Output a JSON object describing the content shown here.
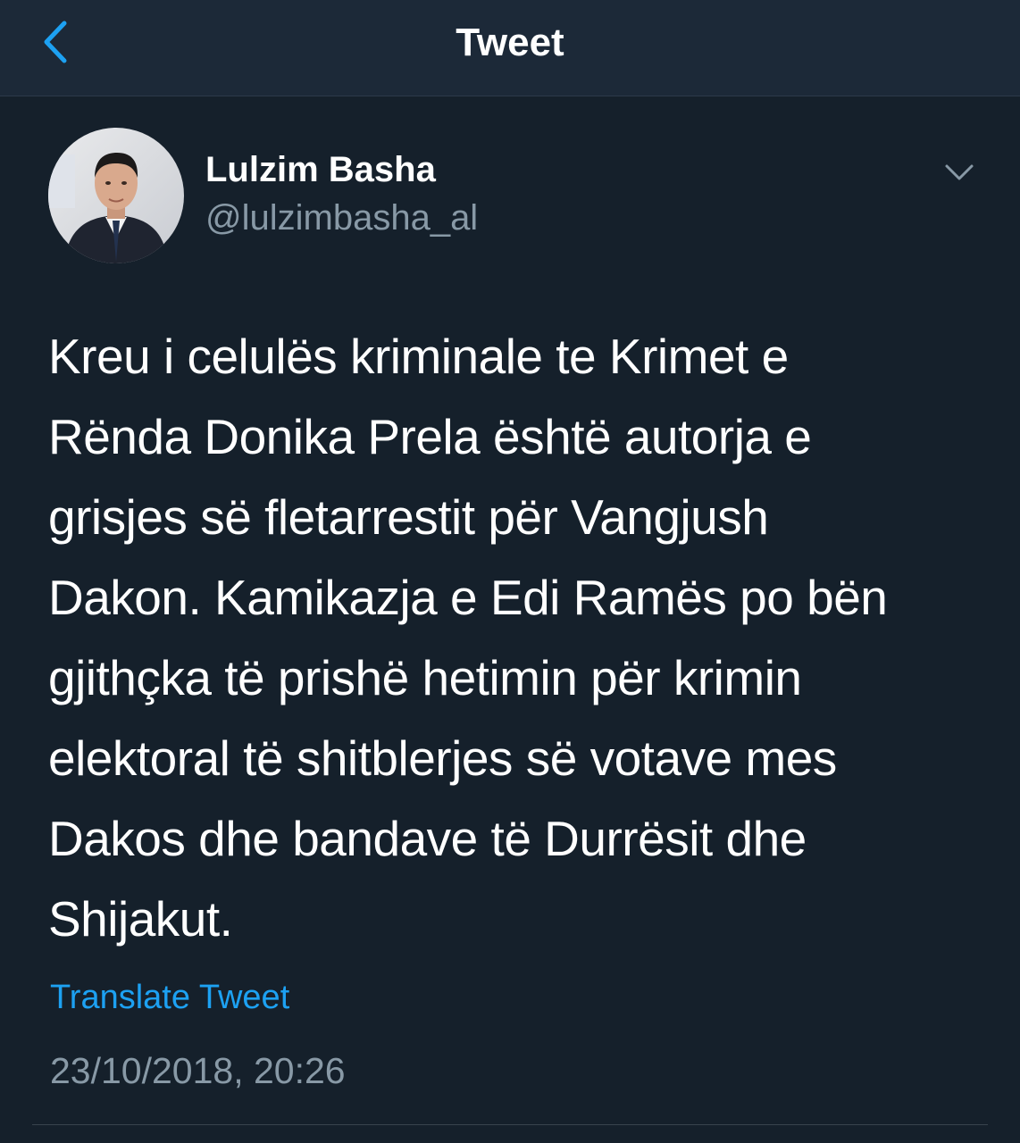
{
  "header": {
    "title": "Tweet",
    "back_icon": "chevron-left-icon"
  },
  "tweet": {
    "author": {
      "display_name": "Lulzim Basha",
      "handle": "@lulzimbasha_al"
    },
    "text": "Kreu i celulës kriminale te Krimet e\nRënda Donika Prela është autorja e\ngrisjes së fletarrestit për Vangjush\nDakon. Kamikazja e Edi Ramës po bën\ngjithçka të prishë hetimin për krimin\nelektoral të shitblerjes së votave mes\nDakos dhe bandave të Durrësit dhe\nShijakut.",
    "translate_label": "Translate Tweet",
    "timestamp": "23/10/2018, 20:26",
    "menu_icon": "chevron-down-icon"
  },
  "colors": {
    "background": "#15202b",
    "header_background": "#1c2938",
    "accent": "#1da1f2",
    "secondary_text": "#8899a6"
  }
}
